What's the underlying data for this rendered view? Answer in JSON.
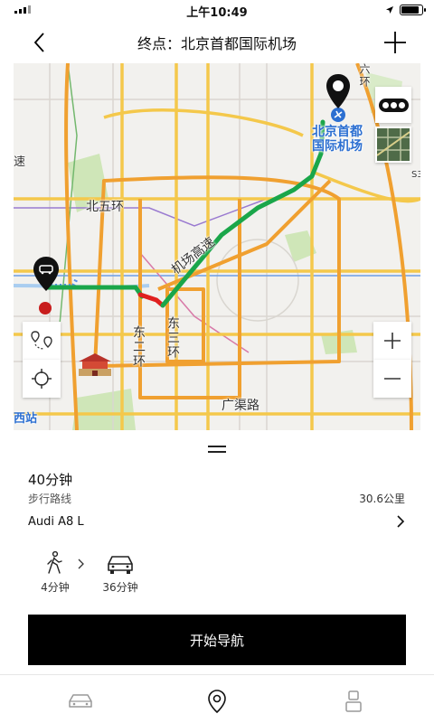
{
  "status_bar": {
    "time": "上午10:49",
    "battery_level": 0.9
  },
  "header": {
    "title": "终点：北京首都国际机场"
  },
  "map": {
    "labels": {
      "airport": "北京首都\n国际机场",
      "north_5th_ring": "北五环",
      "east_2nd_ring": "东二环",
      "east_3rd_ring": "东三环",
      "airport_expressway": "机场高速",
      "guangqu_road": "广渠路",
      "ring_6": "六环",
      "left_speed": "速",
      "west_station": "西站",
      "ring_33": "S3"
    },
    "colors": {
      "route_green": "#1aa64a",
      "route_red": "#e0201f",
      "route_blue": "#5a8fe8"
    }
  },
  "route": {
    "duration": "40分钟",
    "route_type": "步行路线",
    "distance": "30.6公里",
    "vehicle": "Audi A8 L",
    "segments": [
      {
        "mode": "walk-icon",
        "time": "4分钟"
      },
      {
        "mode": "car-icon",
        "time": "36分钟"
      }
    ]
  },
  "actions": {
    "start_navigation": "开始导航"
  },
  "tabs": [
    "car-tab-icon",
    "location-tab-icon",
    "profile-tab-icon"
  ]
}
